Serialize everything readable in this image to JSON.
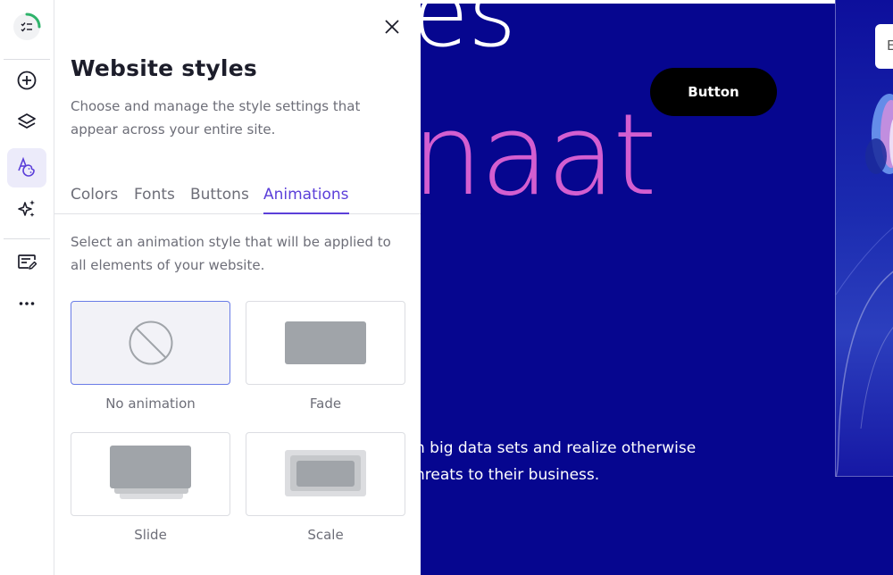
{
  "sidebar": {
    "items": [
      {
        "icon": "add-circle-icon"
      },
      {
        "icon": "layers-icon"
      },
      {
        "icon": "palette-text-icon",
        "active": true
      },
      {
        "icon": "sparkles-icon"
      },
      {
        "icon": "edit-page-icon"
      },
      {
        "icon": "more-dots-icon"
      }
    ]
  },
  "panel": {
    "title": "Website styles",
    "description": "Choose and manage the style settings that appear across your entire site.",
    "tabs": [
      "Colors",
      "Fonts",
      "Buttons",
      "Animations"
    ],
    "active_tab": "Animations",
    "animation_description": "Select an animation style that will be applied to all elements of your website.",
    "animations": [
      {
        "label": "No animation",
        "selected": true
      },
      {
        "label": "Fade",
        "selected": false
      },
      {
        "label": "Slide",
        "selected": false
      },
      {
        "label": "Scale",
        "selected": false
      }
    ]
  },
  "canvas": {
    "heading_line1": "es",
    "heading_line2": "naat",
    "button_label": "Button",
    "body_text": "n big data sets and realize otherwise hreats to their business.",
    "side_letter": "E"
  },
  "colors": {
    "accent": "#5b3fd9",
    "canvas_bg": "#06068f",
    "heading_pink": "#d35ed0",
    "brand_green": "#2fb36b"
  }
}
